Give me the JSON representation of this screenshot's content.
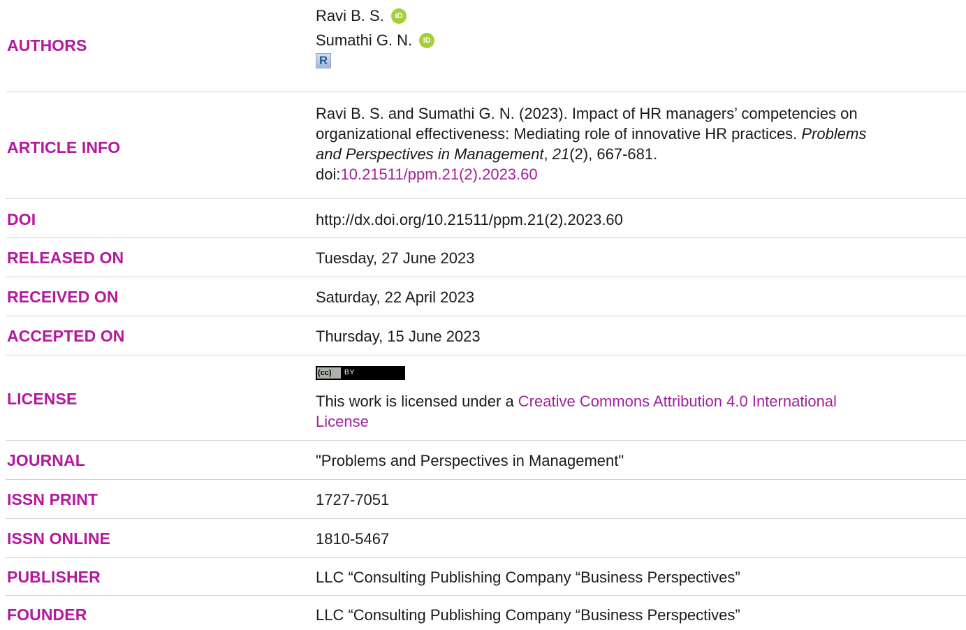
{
  "authors": {
    "label": "AUTHORS",
    "list": [
      {
        "name": "Ravi B. S."
      },
      {
        "name": "Sumathi G. N."
      }
    ],
    "orcid_icon_text": "iD",
    "research_icon_text": "R"
  },
  "article_info": {
    "label": "ARTICLE INFO",
    "line1": "Ravi B. S. and Sumathi G. N. (2023). Impact of HR managers’ competencies on",
    "line2_a": "organizational effectiveness: Mediating role of innovative HR practices. ",
    "line2_b": "Problems",
    "line3_a": "and Perspectives in Management",
    "line3_b": ", ",
    "line3_c": "21",
    "line3_d": "(2), 667-681.",
    "doi_prefix": "doi:",
    "doi_link": "10.21511/ppm.21(2).2023.60"
  },
  "doi": {
    "label": "DOI",
    "value": "http://dx.doi.org/10.21511/ppm.21(2).2023.60"
  },
  "released": {
    "label": "RELEASED ON",
    "value": "Tuesday, 27 June 2023"
  },
  "received": {
    "label": "RECEIVED ON",
    "value": "Saturday, 22 April 2023"
  },
  "accepted": {
    "label": "ACCEPTED ON",
    "value": "Thursday, 15 June 2023"
  },
  "license": {
    "label": "LICENSE",
    "badge_cc": "(cc)",
    "badge_by": "BY",
    "text": "This work is licensed under a ",
    "link_line1": "Creative Commons Attribution 4.0 International",
    "link_line2": "License"
  },
  "journal": {
    "label": "JOURNAL",
    "value": "\"Problems and Perspectives in Management\""
  },
  "issn_print": {
    "label": "ISSN PRINT",
    "value": "1727-7051"
  },
  "issn_online": {
    "label": "ISSN ONLINE",
    "value": "1810-5467"
  },
  "publisher": {
    "label": "PUBLISHER",
    "value": "LLC “Consulting Publishing Company “Business Perspectives”"
  },
  "founder": {
    "label": "FOUNDER",
    "value": "LLC “Consulting Publishing Company “Business Perspectives”"
  },
  "colors": {
    "label": "#b5179e",
    "link": "#a1229a",
    "orcid": "#a6ce39"
  }
}
